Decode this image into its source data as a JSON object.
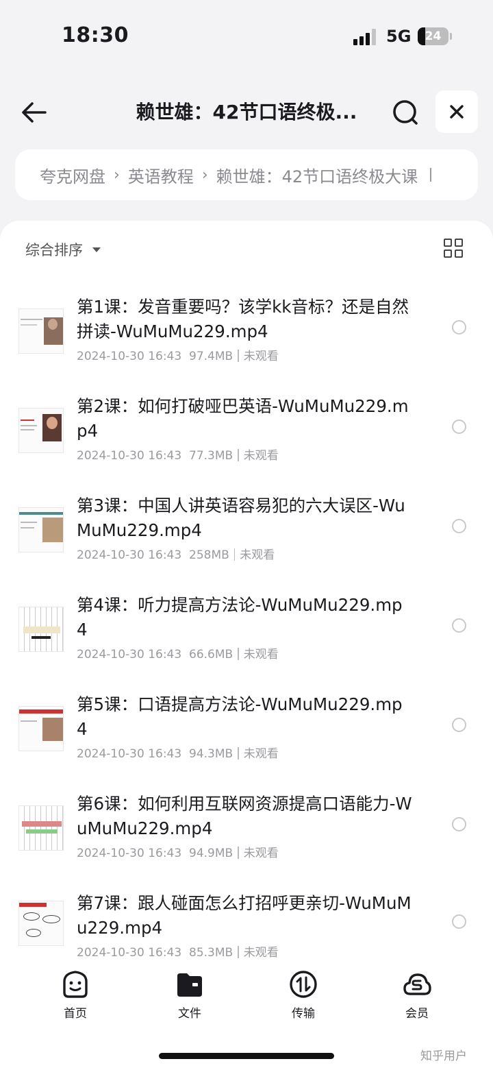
{
  "status_bar": {
    "time": "18:30",
    "network": "5G",
    "battery": "24"
  },
  "header": {
    "title": "赖世雄：42节口语终极..."
  },
  "breadcrumb": {
    "items": [
      "夸克网盘",
      "英语教程",
      "赖世雄：42节口语终极大课"
    ]
  },
  "toolbar": {
    "sort_label": "综合排序"
  },
  "files": [
    {
      "name": "第1课：发音重要吗？该学kk音标？还是自然拼读-WuMuMu229.mp4",
      "date": "2024-10-30 16:43",
      "size": "97.4MB",
      "status": "未观看"
    },
    {
      "name": "第2课：如何打破哑巴英语-WuMuMu229.mp4",
      "date": "2024-10-30 16:43",
      "size": "77.3MB",
      "status": "未观看"
    },
    {
      "name": "第3课：中国人讲英语容易犯的六大误区-WuMuMu229.mp4",
      "date": "2024-10-30 16:43",
      "size": "258MB",
      "status": "未观看"
    },
    {
      "name": "第4课：听力提高方法论-WuMuMu229.mp4",
      "date": "2024-10-30 16:43",
      "size": "66.6MB",
      "status": "未观看"
    },
    {
      "name": "第5课：口语提高方法论-WuMuMu229.mp4",
      "date": "2024-10-30 16:43",
      "size": "94.3MB",
      "status": "未观看"
    },
    {
      "name": "第6课：如何利用互联网资源提高口语能力-WuMuMu229.mp4",
      "date": "2024-10-30 16:43",
      "size": "94.9MB",
      "status": "未观看"
    },
    {
      "name": "第7课：跟人碰面怎么打招呼更亲切-WuMuMu229.mp4",
      "date": "2024-10-30 16:43",
      "size": "85.3MB",
      "status": "未观看"
    }
  ],
  "tabs": [
    {
      "label": "首页",
      "icon": "smile-face-icon"
    },
    {
      "label": "文件",
      "icon": "folder-icon"
    },
    {
      "label": "传输",
      "icon": "transfer-icon"
    },
    {
      "label": "会员",
      "icon": "vip-cloud-icon"
    }
  ],
  "watermark": "知乎用户"
}
